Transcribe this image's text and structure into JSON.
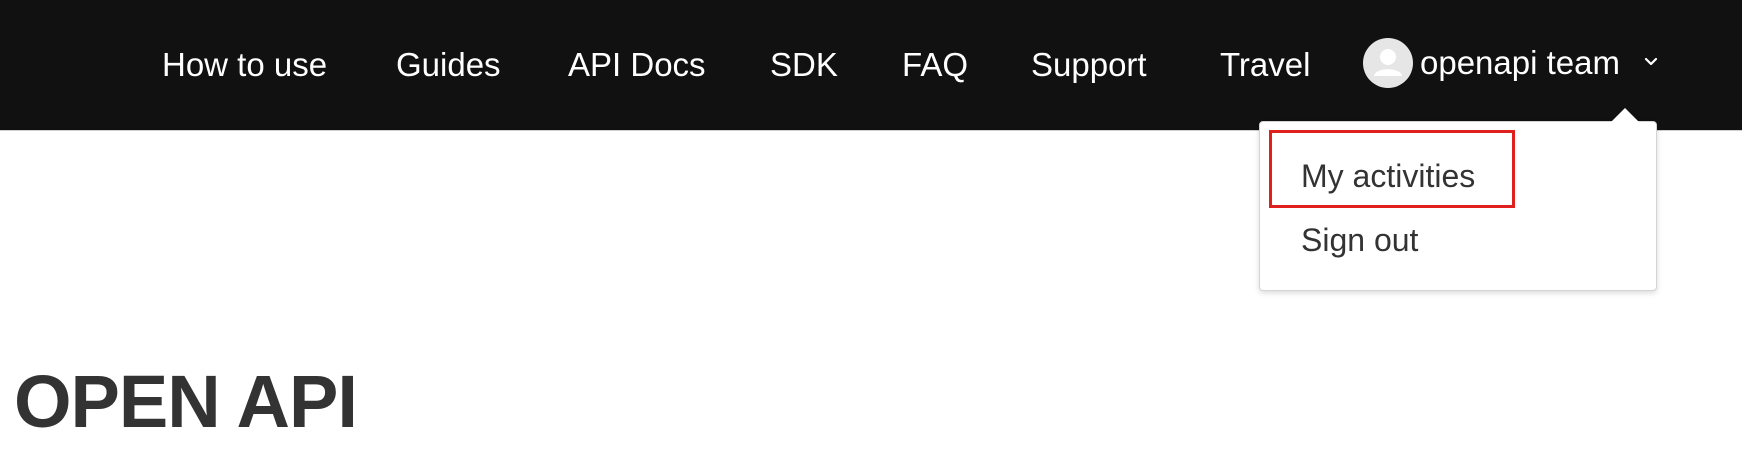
{
  "navbar": {
    "items": [
      {
        "label": "How to use"
      },
      {
        "label": "Guides"
      },
      {
        "label": "API Docs"
      },
      {
        "label": "SDK"
      },
      {
        "label": "FAQ"
      },
      {
        "label": "Support"
      },
      {
        "label": "Travel"
      }
    ],
    "user": {
      "name": "openapi team",
      "avatar_icon": "user-avatar-icon",
      "menu_icon": "chevron-down-icon"
    }
  },
  "dropdown": {
    "items": [
      {
        "label": "My activities"
      },
      {
        "label": "Sign out"
      }
    ],
    "highlight_color": "#e0201c"
  },
  "main": {
    "title": "OPEN API"
  },
  "colors": {
    "navbar_bg": "#111111",
    "nav_text": "#ffffff",
    "body_text": "#333333"
  }
}
